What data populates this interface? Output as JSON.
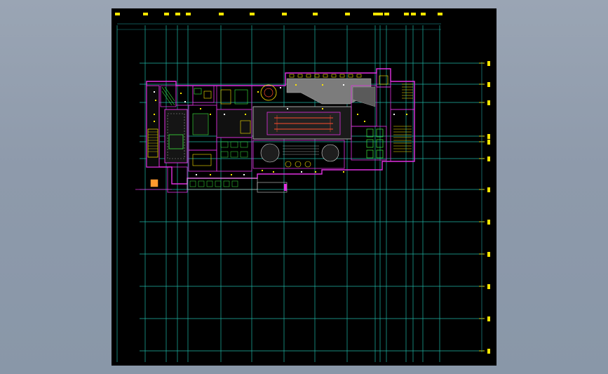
{
  "colors": {
    "background": "#000000",
    "grid": "#1fb6a6",
    "walls": "#e030e0",
    "fixtures": "#ffe600",
    "furniture": "#3df03d",
    "hatch": "#9a9a9a",
    "accent": "#ff4d2e",
    "desktop": "#8e9aab"
  },
  "drawing": {
    "kind": "architectural floor plan",
    "view": "model space"
  }
}
